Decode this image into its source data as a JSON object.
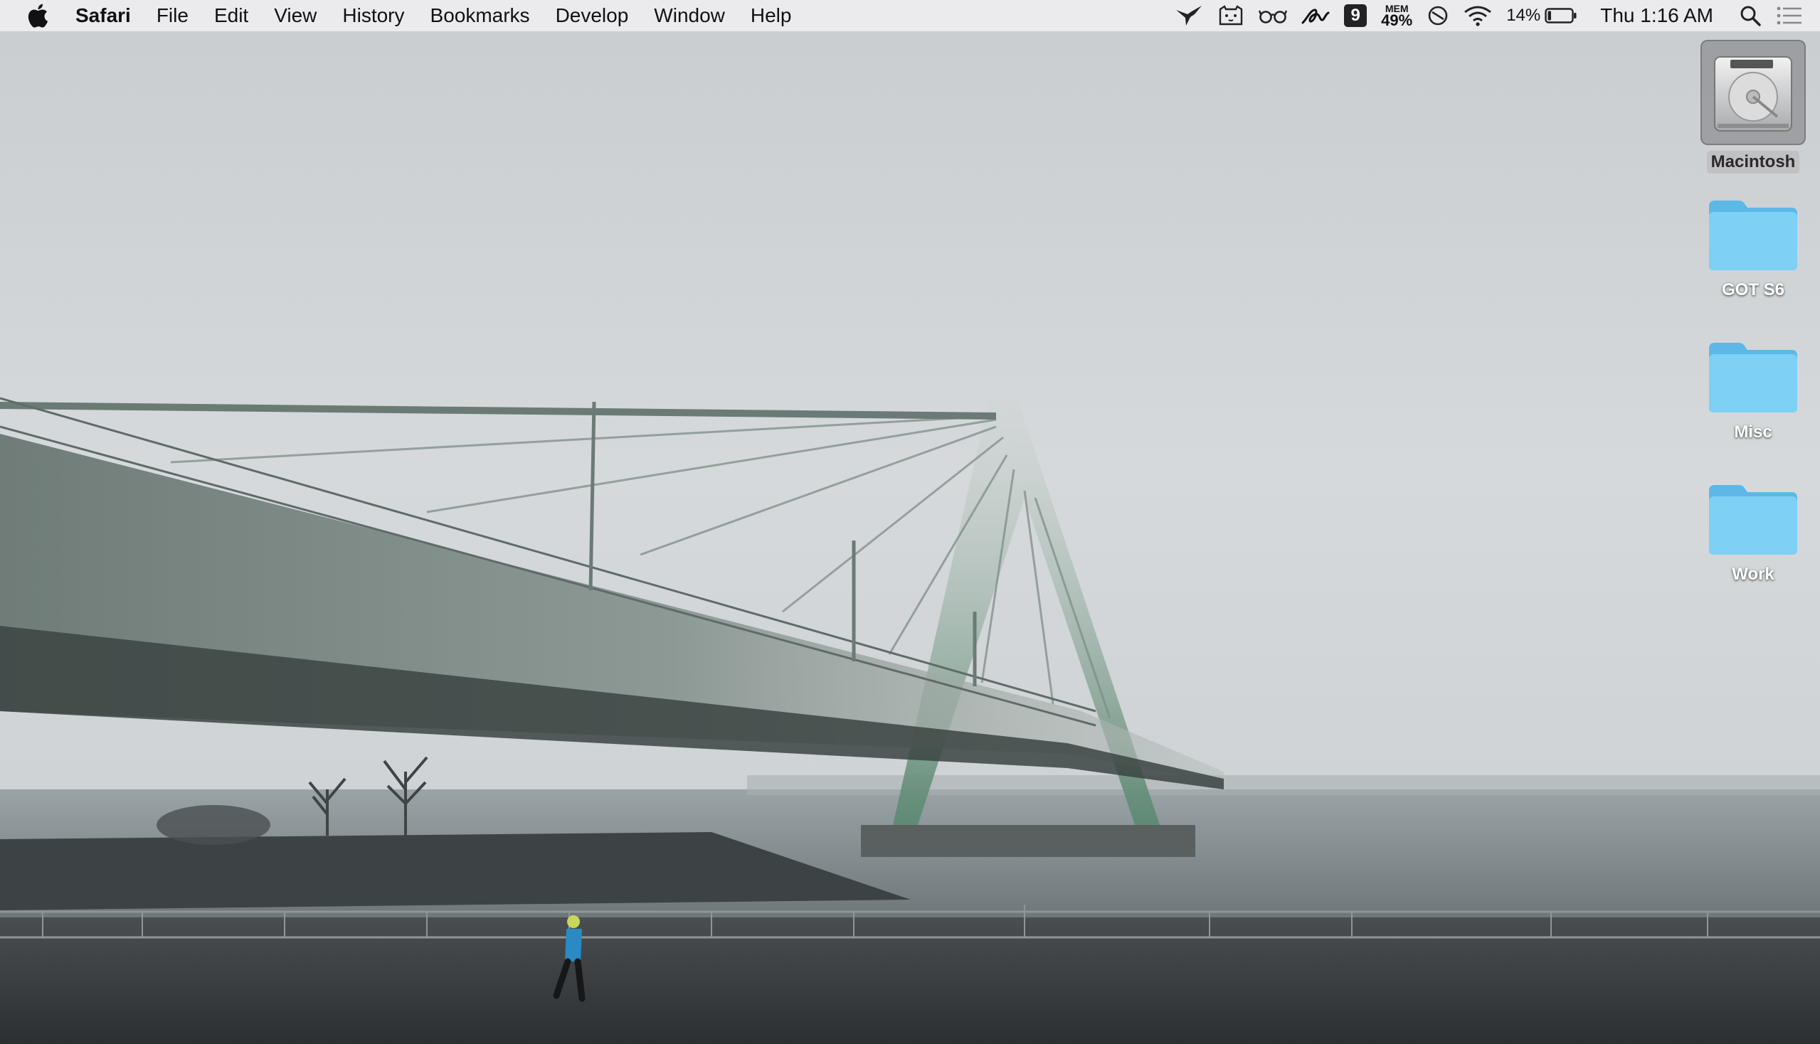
{
  "menubar": {
    "apple_icon": "apple-logo-icon",
    "app_name": "Safari",
    "menus": [
      "File",
      "Edit",
      "View",
      "History",
      "Bookmarks",
      "Develop",
      "Window",
      "Help"
    ],
    "status": {
      "icons": [
        "hummingbird-icon",
        "cat-icon",
        "glasses-icon",
        "signature-icon"
      ],
      "badge_count": "9",
      "mem_label": "MEM",
      "mem_value": "49%",
      "wifi_icon": "wifi-icon",
      "battery_percent": "14%",
      "battery_level": 0.14,
      "clock": "Thu 1:16 AM",
      "search_icon": "spotlight-search-icon",
      "notifications_icon": "notification-center-icon"
    }
  },
  "desktop": {
    "icons": [
      {
        "label": "Macintosh",
        "type": "hard-drive",
        "selected": true
      },
      {
        "label": "GOT S6",
        "type": "folder",
        "selected": false
      },
      {
        "label": "Misc",
        "type": "folder",
        "selected": false
      },
      {
        "label": "Work",
        "type": "folder",
        "selected": false
      }
    ],
    "wallpaper": "foggy cable-stayed bridge over river with runner on promenade",
    "folder_color": "#6fc8f0"
  }
}
